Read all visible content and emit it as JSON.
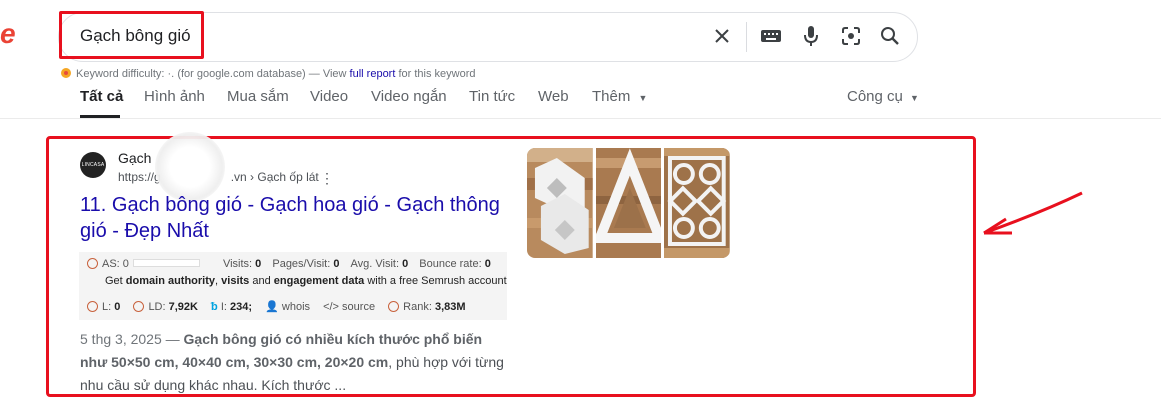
{
  "logo_fragment": "e",
  "search": {
    "query": "Gạch bông gió",
    "icons": [
      "clear-icon",
      "keyboard-icon",
      "microphone-icon",
      "lens-icon",
      "search-icon"
    ]
  },
  "keyword_difficulty": {
    "label": "Keyword difficulty:",
    "value": "·.",
    "middle": "(for google.com database) — View",
    "link": "full report",
    "suffix": "for this keyword"
  },
  "tabs": [
    "Tất cả",
    "Hình ảnh",
    "Mua sắm",
    "Video",
    "Video ngắn",
    "Tin tức",
    "Web",
    "Thêm"
  ],
  "active_tab": "Tất cả",
  "tools_label": "Công cụ",
  "result": {
    "favicon_text": "LINCASA",
    "site_name": "Gạch",
    "url": "https://g",
    "url_tail": ".vn › Gạch ốp lát",
    "rank_prefix": "11.",
    "title": "Gạch bông gió - Gạch hoa gió - Gạch thông gió - Đẹp Nhất",
    "semrush": {
      "as": "AS: 0",
      "visits": "Visits:",
      "visits_val": "0",
      "pages": "Pages/Visit:",
      "pages_val": "0",
      "avg": "Avg. Visit:",
      "avg_val": "0",
      "bounce": "Bounce rate:",
      "bounce_val": "0",
      "note_pre": "Get",
      "note_b1": "domain authority",
      "note_mid": ",",
      "note_b2": "visits",
      "note_and": "and",
      "note_b3": "engagement data",
      "note_post": "with a free Semrush account",
      "l": "L:",
      "l_val": "0",
      "ld": "LD:",
      "ld_val": "7,92K",
      "i": "I:",
      "i_val": "234;",
      "whois": "whois",
      "source": "source",
      "rank": "Rank:",
      "rank_val": "3,83M"
    },
    "snippet_date": "5 thg 3, 2025 —",
    "snippet_bold": "Gạch bông gió có nhiều kích thước phổ biến như 50×50 cm, 40×40 cm, 30×30 cm, 20×20 cm",
    "snippet_rest": ", phù hợp với từng nhu cầu sử dụng khác nhau. Kích thước ..."
  },
  "colors": {
    "highlight_red": "#e8101e",
    "link_blue": "#1a0dab",
    "semrush_orange": "#c8623d"
  }
}
